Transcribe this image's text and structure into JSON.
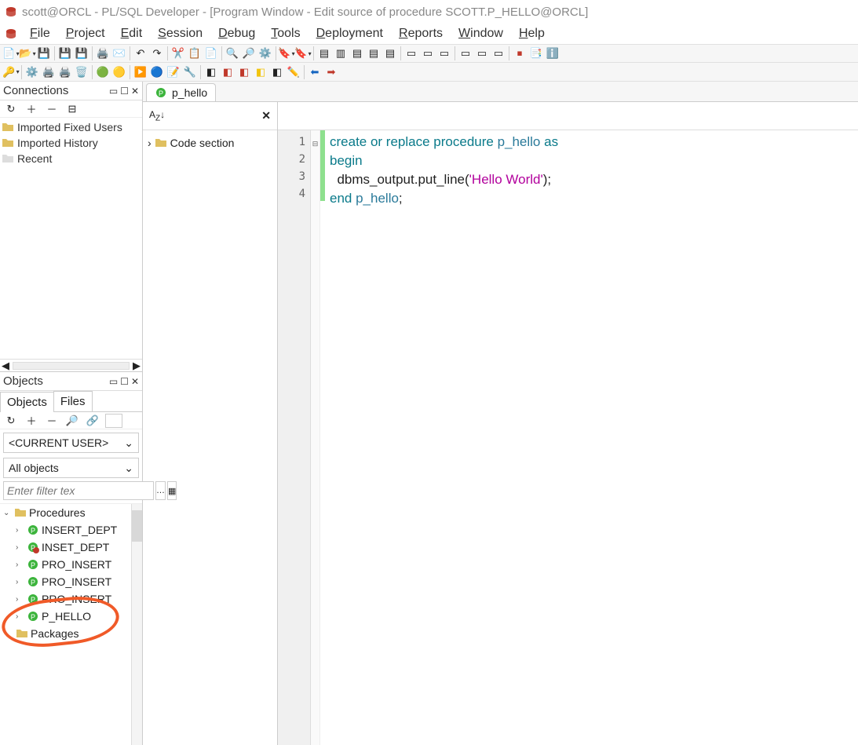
{
  "title": "scott@ORCL - PL/SQL Developer - [Program Window - Edit source of procedure SCOTT.P_HELLO@ORCL]",
  "menu": [
    "File",
    "Project",
    "Edit",
    "Session",
    "Debug",
    "Tools",
    "Deployment",
    "Reports",
    "Window",
    "Help"
  ],
  "conn": {
    "title": "Connections",
    "items": [
      "Imported Fixed Users",
      "Imported History",
      "Recent"
    ]
  },
  "objects": {
    "title": "Objects",
    "tabs": [
      "Objects",
      "Files"
    ],
    "user_dd": "<CURRENT USER>",
    "scope_dd": "All objects",
    "filter_ph": "Enter filter tex",
    "tree": {
      "root": "Procedures",
      "items": [
        "INSERT_DEPT",
        "INSET_DEPT",
        "PRO_INSERT",
        "PRO_INSERT",
        "PRO_INSERT",
        "P_HELLO"
      ],
      "after": "Packages"
    }
  },
  "doc_tab": "p_hello",
  "outline": {
    "root": "Code section"
  },
  "editor": {
    "lines": [
      1,
      2,
      3,
      4
    ],
    "code": [
      {
        "t": "create or replace procedure ",
        "c": "kw"
      },
      {
        "t": "p_hello",
        "c": "ident"
      },
      {
        "t": " as",
        "c": "kw"
      },
      {
        "t": "\n"
      },
      {
        "t": "begin",
        "c": "kw"
      },
      {
        "t": "\n"
      },
      {
        "t": "  dbms_output.put_line(",
        "c": "plain"
      },
      {
        "t": "'Hello World'",
        "c": "str"
      },
      {
        "t": ");",
        "c": "plain"
      },
      {
        "t": "\n"
      },
      {
        "t": "end ",
        "c": "kw"
      },
      {
        "t": "p_hello",
        "c": "ident"
      },
      {
        "t": ";",
        "c": "plain"
      }
    ]
  }
}
